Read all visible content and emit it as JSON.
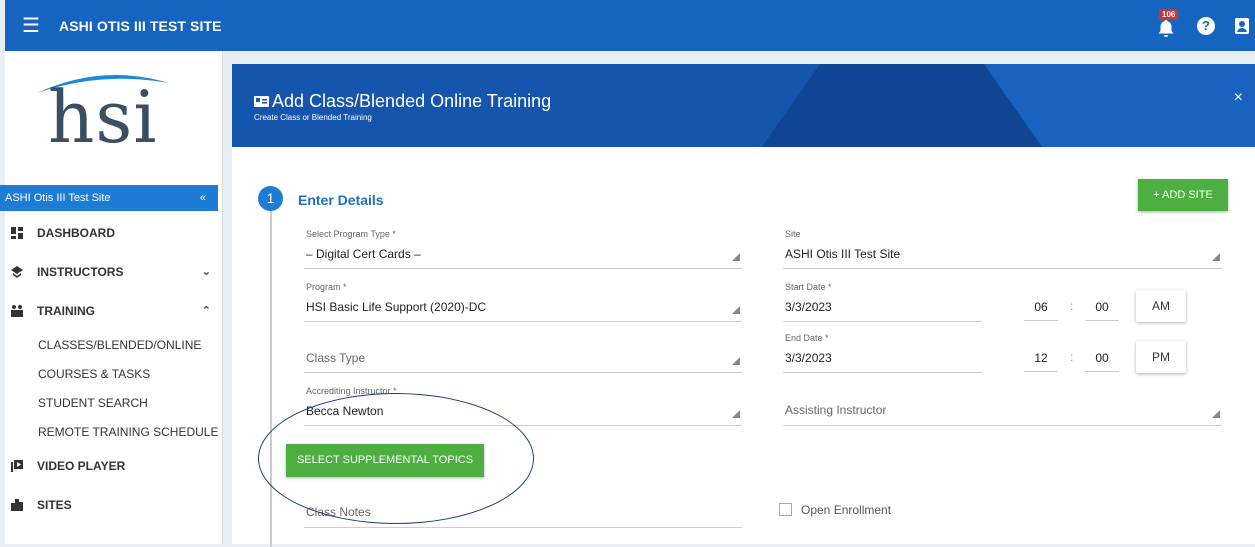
{
  "topbar": {
    "title": "ASHI OTIS III TEST SITE",
    "notification_count": "106",
    "help": "?"
  },
  "sidebar": {
    "logo_text": "hsi",
    "site_name": "ASHI Otis III Test Site",
    "collapse": "«",
    "nav": [
      {
        "label": "DASHBOARD"
      },
      {
        "label": "INSTRUCTORS",
        "chevron": "⌄"
      },
      {
        "label": "TRAINING",
        "chevron": "⌃"
      }
    ],
    "training_sub": [
      "CLASSES/BLENDED/ONLINE",
      "COURSES & TASKS",
      "STUDENT SEARCH",
      "REMOTE TRAINING SCHEDULE"
    ],
    "nav2": [
      {
        "label": "VIDEO PLAYER"
      },
      {
        "label": "SITES"
      }
    ]
  },
  "header": {
    "title": "Add Class/Blended Online Training",
    "subtitle": "Create Class or Blended Training",
    "close": "×"
  },
  "step": {
    "number": "1",
    "title": "Enter Details",
    "add_site": "+ ADD SITE"
  },
  "form": {
    "program_type": {
      "label": "Select Program Type *",
      "value": "– Digital Cert Cards –"
    },
    "site": {
      "label": "Site",
      "value": "ASHI Otis III Test Site"
    },
    "program": {
      "label": "Program *",
      "value": "HSI Basic Life Support (2020)-DC"
    },
    "start_date": {
      "label": "Start Date *",
      "value": "3/3/2023",
      "hour": "06",
      "minute": "00",
      "ampm": "AM"
    },
    "class_type": {
      "placeholder": "Class Type"
    },
    "end_date": {
      "label": "End Date *",
      "value": "3/3/2023",
      "hour": "12",
      "minute": "00",
      "ampm": "PM"
    },
    "accrediting_instructor": {
      "label": "Accrediting Instructor *",
      "value": "Becca Newton"
    },
    "assisting_instructor": {
      "placeholder": "Assisting Instructor"
    },
    "supplemental_button": "SELECT SUPPLEMENTAL TOPICS",
    "class_notes": {
      "placeholder": "Class Notes"
    },
    "open_enrollment": "Open Enrollment",
    "colon": ":"
  }
}
